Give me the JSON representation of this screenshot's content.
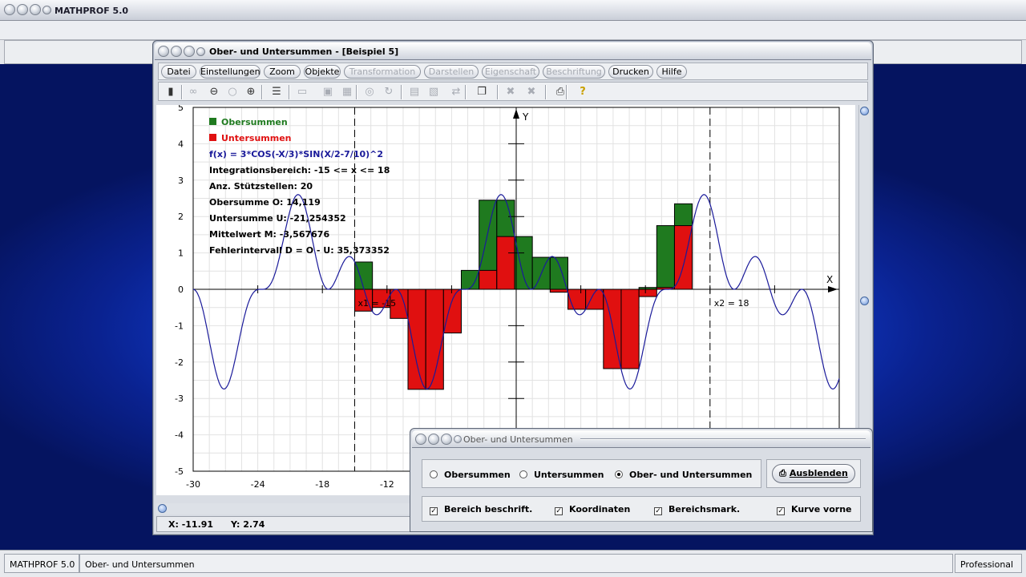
{
  "app": {
    "title": "MATHPROF 5.0"
  },
  "window": {
    "title": "Ober- und Untersummen - [Beispiel 5]"
  },
  "menu": [
    {
      "label": "Datei",
      "enabled": true
    },
    {
      "label": "Einstellungen",
      "enabled": true
    },
    {
      "label": "Zoom",
      "enabled": true
    },
    {
      "label": "Objekte",
      "enabled": true
    },
    {
      "label": "Transformation",
      "enabled": false
    },
    {
      "label": "Darstellen",
      "enabled": false
    },
    {
      "label": "Eigenschaft",
      "enabled": false
    },
    {
      "label": "Beschriftung",
      "enabled": false
    },
    {
      "label": "Drucken",
      "enabled": true
    },
    {
      "label": "Hilfe",
      "enabled": true
    }
  ],
  "toolbar": [
    "calculator-icon",
    "glasses-icon",
    "zoom-out-icon",
    "zoom-reset-icon",
    "zoom-in-icon",
    "clipboard-icon",
    "window-icon",
    "box-icon",
    "grid-icon",
    "copy-icon",
    "recycle-icon",
    "table-icon",
    "table-image-icon",
    "export-icon",
    "pages-icon",
    "delete-icon",
    "delete-all-icon",
    "printer-icon",
    "help-icon"
  ],
  "chart_data": {
    "type": "bar",
    "function": "f(x) = 3*COS(-X/3)*SIN(X/2-7/10)^2",
    "x_label": "X",
    "y_label": "Y",
    "xlim": [
      -30,
      30
    ],
    "ylim": [
      -5,
      5
    ],
    "x_ticks": [
      "-30",
      "-24",
      "-18",
      "-12"
    ],
    "y_ticks": [
      "5",
      "4",
      "3",
      "2",
      "1",
      "0",
      "-1",
      "-2",
      "-3",
      "-4",
      "-5"
    ],
    "grid": true,
    "legend": "top-left",
    "x1_label": "x1 = -15",
    "x2_label": "x2 = 18",
    "interval": [
      -15,
      18
    ],
    "series": [
      {
        "name": "Obersummen",
        "color": "#1f7a1f"
      },
      {
        "name": "Untersummen",
        "color": "#e01010"
      }
    ],
    "info_lines": [
      "Integrationsbereich: -15 <= x <= 18",
      "Anz. Stützstellen: 20",
      "Obersumme O: 14,119",
      "Untersumme U: -21,254352",
      "Mittelwert M: -3,567676",
      "Fehlerintervall D = O - U: 35,373352"
    ],
    "bars": [
      {
        "x0": -15,
        "x1": -13.35,
        "upper": 0.75,
        "lower": -0.6
      },
      {
        "x0": -13.35,
        "x1": -11.7,
        "upper": -0.15,
        "lower": -0.5
      },
      {
        "x0": -11.7,
        "x1": -10.05,
        "upper": -0.15,
        "lower": -0.8
      },
      {
        "x0": -10.05,
        "x1": -8.4,
        "upper": -0.8,
        "lower": -2.75
      },
      {
        "x0": -8.4,
        "x1": -6.75,
        "upper": -1.2,
        "lower": -2.75
      },
      {
        "x0": -6.75,
        "x1": -5.1,
        "upper": 0,
        "lower": -1.2
      },
      {
        "x0": -5.1,
        "x1": -3.45,
        "upper": 0.52,
        "lower": 0
      },
      {
        "x0": -3.45,
        "x1": -1.8,
        "upper": 2.45,
        "lower": 0.52
      },
      {
        "x0": -1.8,
        "x1": -0.15,
        "upper": 2.45,
        "lower": 1.45
      },
      {
        "x0": -0.15,
        "x1": 1.5,
        "upper": 1.45,
        "lower": 0
      },
      {
        "x0": 1.5,
        "x1": 3.15,
        "upper": 0.88,
        "lower": 0
      },
      {
        "x0": 3.15,
        "x1": 4.8,
        "upper": 0.88,
        "lower": -0.08
      },
      {
        "x0": 4.8,
        "x1": 6.45,
        "upper": -0.05,
        "lower": -0.55
      },
      {
        "x0": 6.45,
        "x1": 8.1,
        "upper": -0.05,
        "lower": -0.55
      },
      {
        "x0": 8.1,
        "x1": 9.75,
        "upper": -0.1,
        "lower": -2.18
      },
      {
        "x0": 9.75,
        "x1": 11.4,
        "upper": -0.1,
        "lower": -2.18
      },
      {
        "x0": 11.4,
        "x1": 13.05,
        "upper": 0.05,
        "lower": -0.2
      },
      {
        "x0": 13.05,
        "x1": 14.7,
        "upper": 1.75,
        "lower": 0.05
      },
      {
        "x0": 14.7,
        "x1": 16.35,
        "upper": 2.35,
        "lower": 1.75
      }
    ]
  },
  "coords": {
    "x": "X: -11.91",
    "y": "Y: 2.74"
  },
  "dialog": {
    "title": "Ober- und Untersummen",
    "radios": [
      {
        "label": "Obersummen",
        "selected": false
      },
      {
        "label": "Untersummen",
        "selected": false
      },
      {
        "label": "Ober- und Untersummen",
        "selected": true
      }
    ],
    "button": "Ausblenden",
    "checks": [
      {
        "label": "Bereich beschrift.",
        "checked": true
      },
      {
        "label": "Koordinaten",
        "checked": true
      },
      {
        "label": "Bereichsmark.",
        "checked": true
      },
      {
        "label": "Kurve vorne",
        "checked": true
      }
    ]
  },
  "status": {
    "left": "MATHPROF 5.0",
    "middle": "Ober- und Untersummen",
    "right": "Professional"
  }
}
